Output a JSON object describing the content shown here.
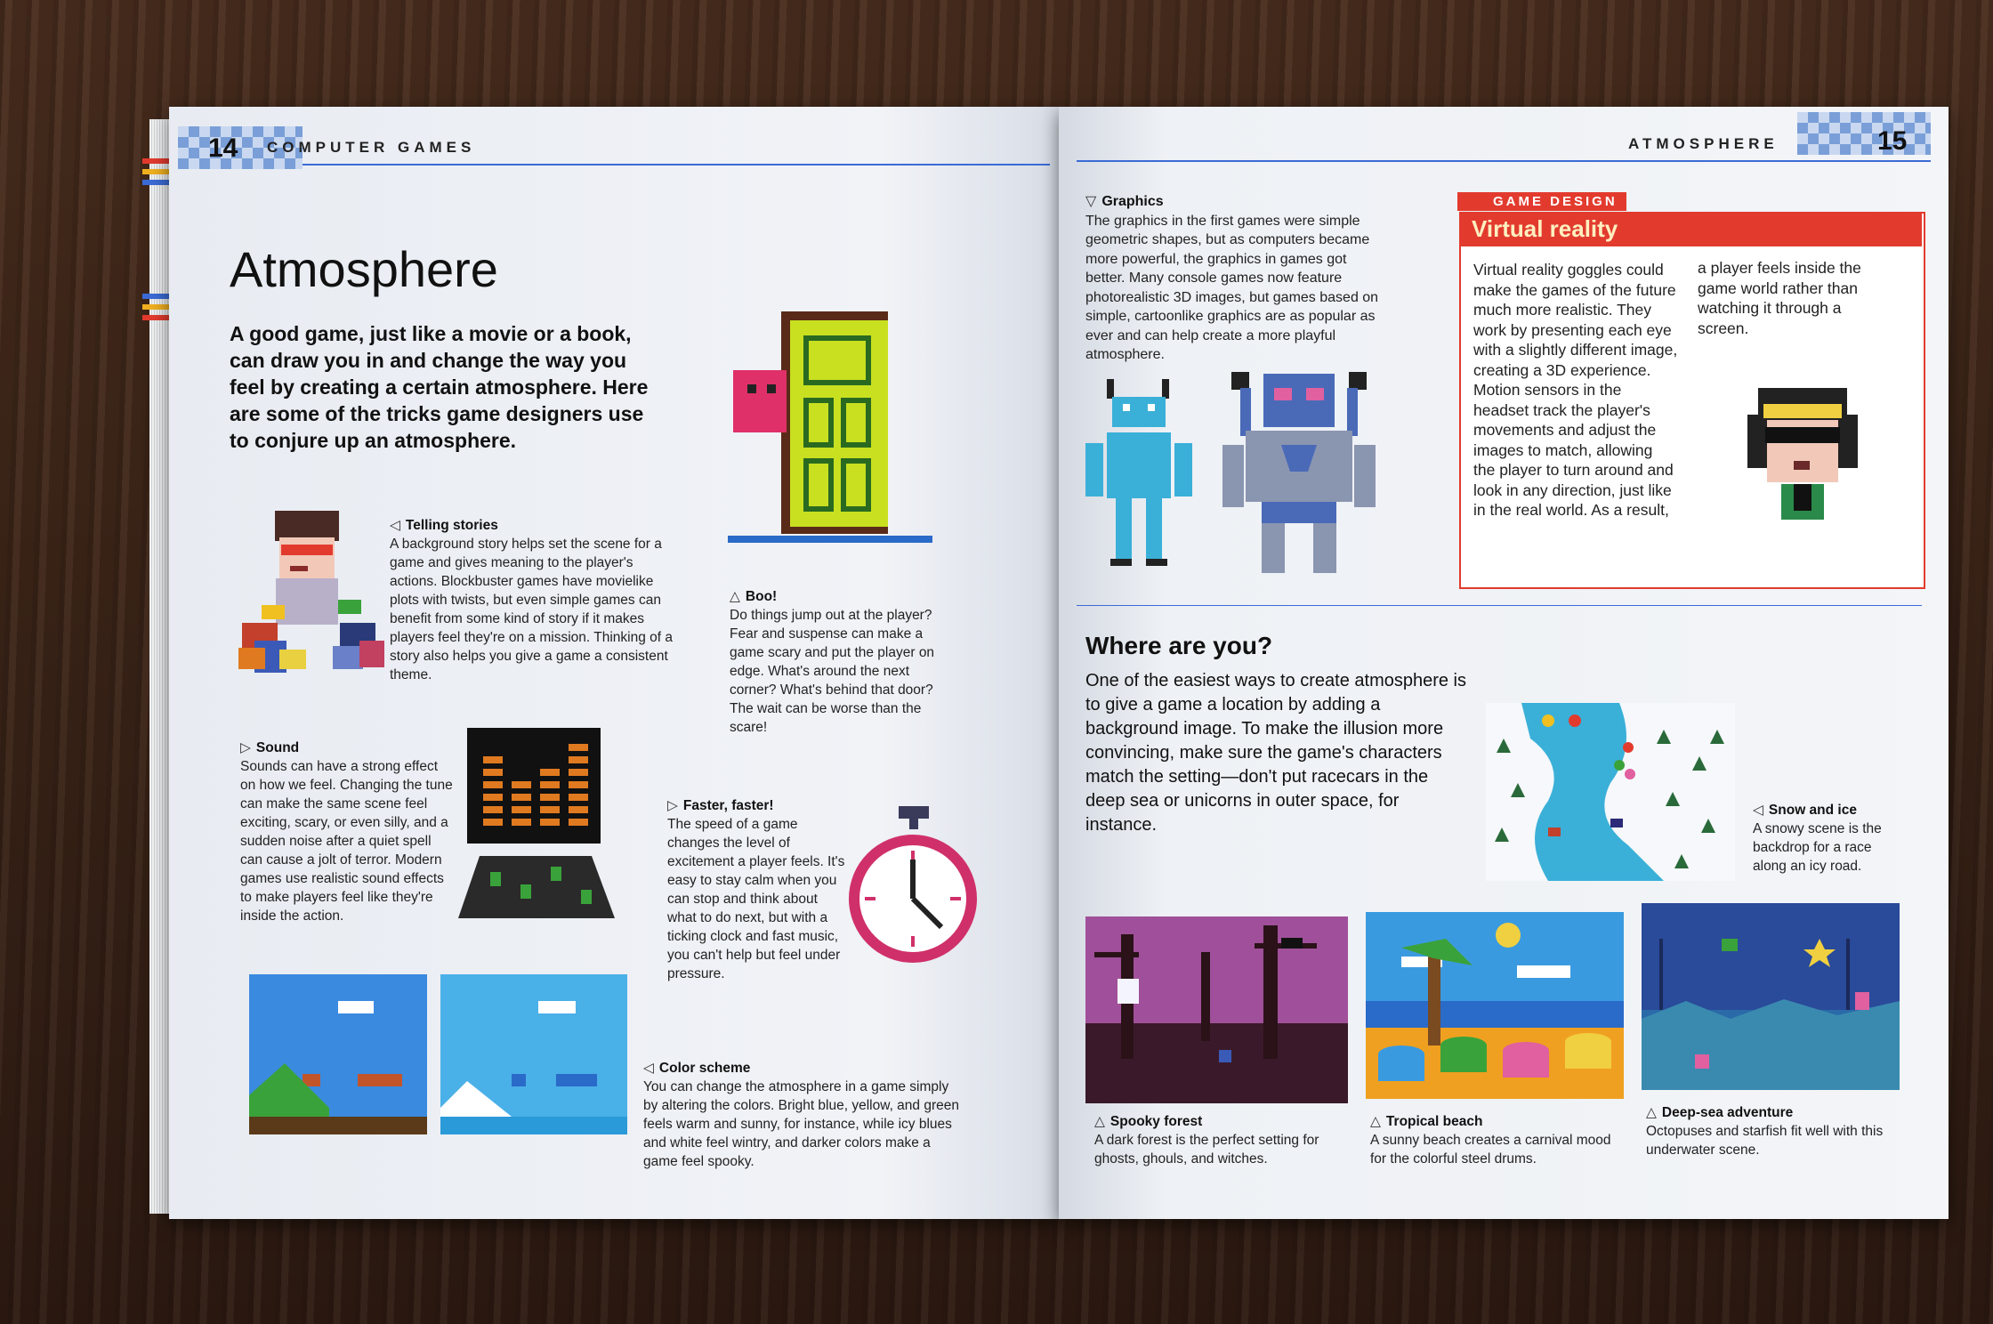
{
  "left_page": {
    "page_number": "14",
    "running_head": "COMPUTER GAMES",
    "title": "Atmosphere",
    "intro": "A good game, just like a movie or a book, can draw you in and change the way you feel by creating a certain atmosphere. Here are some of the tricks game designers use to conjure up an atmosphere.",
    "telling_stories": {
      "marker": "◁",
      "heading": "Telling stories",
      "text": "A background story helps set the scene for a game and gives meaning to the player's actions. Blockbuster games have movielike plots with twists, but even simple games can benefit from some kind of story if it makes players feel they're on a mission. Thinking of a story also helps you give a game a consistent theme."
    },
    "boo": {
      "marker": "△",
      "heading": "Boo!",
      "text": "Do things jump out at the player? Fear and suspense can make a game scary and put the player on edge. What's around the next corner? What's behind that door? The wait can be worse than the scare!"
    },
    "sound": {
      "marker": "▷",
      "heading": "Sound",
      "text": "Sounds can have a strong effect on how we feel. Changing the tune can make the same scene feel exciting, scary, or even silly, and a sudden noise after a quiet spell can cause a jolt of terror. Modern games use realistic sound effects to make players feel like they're inside the action."
    },
    "faster": {
      "marker": "▷",
      "heading": "Faster, faster!",
      "text": "The speed of a game changes the level of excitement a player feels. It's easy to stay calm when you can stop and think about what to do next, but with a ticking clock and fast music, you can't help but feel under pressure."
    },
    "color_scheme": {
      "marker": "◁",
      "heading": "Color scheme",
      "text": "You can change the atmosphere in a game simply by altering the colors. Bright blue, yellow, and green feels warm and sunny, for instance, while icy blues and white feel wintry, and darker colors make a game feel spooky."
    }
  },
  "right_page": {
    "page_number": "15",
    "running_head": "ATMOSPHERE",
    "graphics": {
      "marker": "▽",
      "heading": "Graphics",
      "text": "The graphics in the first games were simple geometric shapes, but as computers became more powerful, the graphics in games got better. Many console games now feature photorealistic 3D images, but games based on simple, cartoonlike graphics are as popular as ever and can help create a more playful atmosphere."
    },
    "game_design": {
      "tab": "GAME DESIGN",
      "title": "Virtual reality",
      "col1": "Virtual reality goggles could make the games of the future much more realistic. They work by presenting each eye with a slightly different image, creating a 3D experience. Motion sensors in the headset track the player's movements and adjust the images to match, allowing the player to turn around and look in any direction, just like in the real world. As a result,",
      "col2": "a player feels inside the game world rather than watching it through a screen."
    },
    "where": {
      "heading": "Where are you?",
      "text": "One of the easiest ways to create atmosphere is to give a game a location by adding a background image. To make the illusion more convincing, make sure the game's characters match the setting—don't put racecars in the deep sea or unicorns in outer space, for instance."
    },
    "snow": {
      "marker": "◁",
      "heading": "Snow and ice",
      "text": "A snowy scene is the backdrop for a race along an icy road."
    },
    "spooky": {
      "marker": "△",
      "heading": "Spooky forest",
      "text": "A dark forest is the perfect setting for ghosts, ghouls, and witches."
    },
    "tropical": {
      "marker": "△",
      "heading": "Tropical beach",
      "text": "A sunny beach creates a carnival mood for the colorful steel drums."
    },
    "deepsea": {
      "marker": "△",
      "heading": "Deep-sea adventure",
      "text": "Octopuses and starfish fit well with this underwater scene."
    }
  },
  "colors": {
    "accent_blue": "#3b6bd6",
    "accent_red": "#e23b2e"
  }
}
